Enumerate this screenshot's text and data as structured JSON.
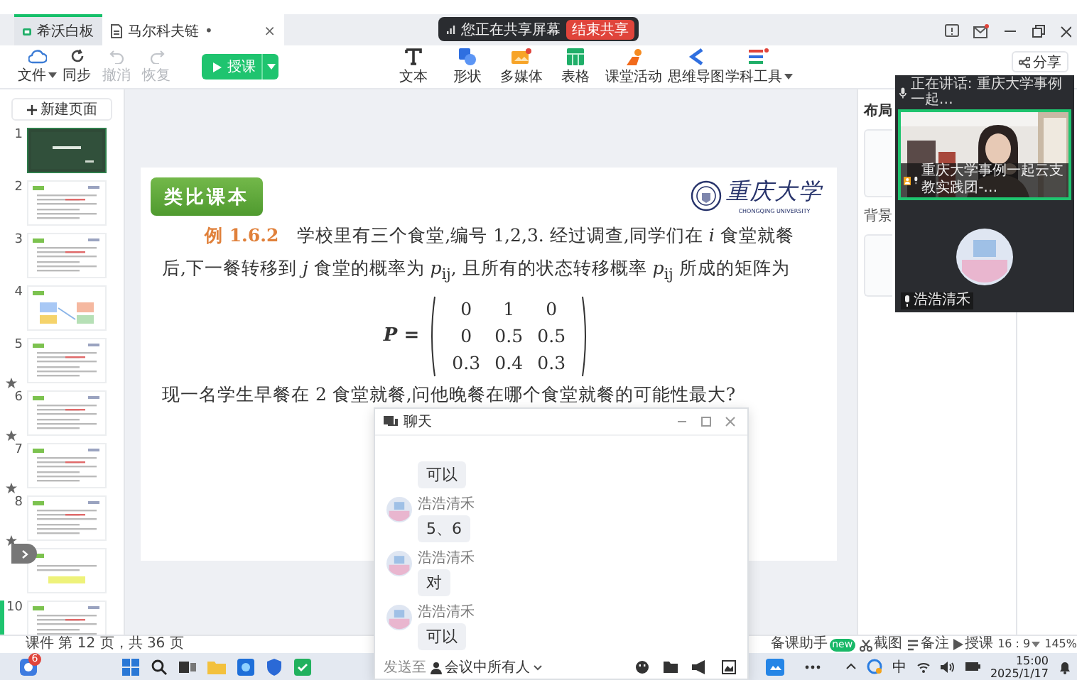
{
  "title_bar": {
    "tabs": [
      {
        "kind": "app",
        "label": "希沃白板",
        "selected": false
      },
      {
        "kind": "doc",
        "label": "马尔科夫链",
        "unsaved_mark": "•",
        "close": "×",
        "selected": true
      }
    ],
    "share_notice": "您正在共享屏幕",
    "stop_share": "结束共享"
  },
  "toolbar": {
    "left": [
      {
        "label": "文件",
        "dropdown": true,
        "disabled": false
      },
      {
        "label": "同步",
        "dropdown": false,
        "disabled": false
      },
      {
        "label": "撤消",
        "dropdown": false,
        "disabled": true
      },
      {
        "label": "恢复",
        "dropdown": false,
        "disabled": true
      }
    ],
    "teach_button": "授课",
    "tools": [
      {
        "label": "文本",
        "dropdown": false
      },
      {
        "label": "形状",
        "dropdown": false
      },
      {
        "label": "多媒体",
        "dropdown": false
      },
      {
        "label": "表格",
        "dropdown": false
      },
      {
        "label": "课堂活动",
        "dropdown": false
      },
      {
        "label": "思维导图",
        "dropdown": false
      },
      {
        "label": "学科工具",
        "dropdown": true
      }
    ],
    "share": "分享"
  },
  "sidebar": {
    "new_page": "新建页面",
    "thumbnails": [
      {
        "number": "1",
        "kind": "title",
        "starred": false,
        "selected": false
      },
      {
        "number": "2",
        "kind": "text",
        "starred": false,
        "selected": false
      },
      {
        "number": "3",
        "kind": "text",
        "starred": false,
        "selected": false
      },
      {
        "number": "4",
        "kind": "diagram",
        "starred": false,
        "selected": false
      },
      {
        "number": "5",
        "kind": "text",
        "starred": true,
        "selected": false
      },
      {
        "number": "6",
        "kind": "text",
        "starred": true,
        "selected": false
      },
      {
        "number": "7",
        "kind": "text",
        "starred": true,
        "selected": false
      },
      {
        "number": "8",
        "kind": "text",
        "starred": true,
        "selected": false
      },
      {
        "kind": "note",
        "starred": false,
        "selected": false
      },
      {
        "number": "10",
        "kind": "text",
        "starred": false,
        "selected": true
      }
    ]
  },
  "slide": {
    "tag": "类比课本",
    "logo": {
      "name": "重庆大学",
      "subtitle": "CHONGQING UNIVERSITY"
    },
    "paragraph": "**例 1.6.2**　学校里有三个食堂,编号 1,2,3. 经过调查,同学们在 *i* 食堂就餐后,下一餐转移到 *j* 食堂的概率为 *p*$_{ij}$, 且所有的状态转移概率 *p*$_{ij}$ 所成的矩阵为",
    "matrix": {
      "label": "P =",
      "rows": [
        [
          "0",
          "1",
          "0"
        ],
        [
          "0",
          "0.5",
          "0.5"
        ],
        [
          "0.3",
          "0.4",
          "0.3"
        ]
      ]
    },
    "question": "现一名学生早餐在 2 食堂就餐,问他晚餐在哪个食堂就餐的可能性最大?"
  },
  "right_panel": {
    "layout_title": "布局",
    "background_title": "背景"
  },
  "video_panel": {
    "speaking": "正在讲话:  重庆大学事例一起…",
    "tiles": [
      {
        "kind": "video",
        "name": "重庆大学事例一起云支教实践团-…",
        "active": true
      },
      {
        "kind": "avatar",
        "name": "浩浩清禾",
        "active": false
      }
    ]
  },
  "chat": {
    "title": "聊天",
    "messages": [
      {
        "text": "可以"
      },
      {
        "sender": "浩浩清禾",
        "text": "5、6"
      },
      {
        "sender": "浩浩清禾",
        "text": "对"
      },
      {
        "sender": "浩浩清禾",
        "text": "可以"
      }
    ],
    "send_to_label": "发送至",
    "recipient": "会议中所有人"
  },
  "status_bar": {
    "page_info": "课件 第 12 页，共 36 页",
    "items": [
      {
        "label": "备课助手",
        "badge": "new",
        "dropdown": false
      },
      {
        "label": "截图",
        "dropdown": false
      },
      {
        "label": "备注",
        "dropdown": false
      },
      {
        "label": "授课",
        "dropdown": false
      },
      {
        "label": "16 : 9",
        "dropdown": true
      },
      {
        "label": "145%",
        "dropdown": false
      }
    ]
  },
  "taskbar": {
    "badge": "6",
    "ime": "中",
    "time": "15:00",
    "date": "2025/1/17"
  }
}
